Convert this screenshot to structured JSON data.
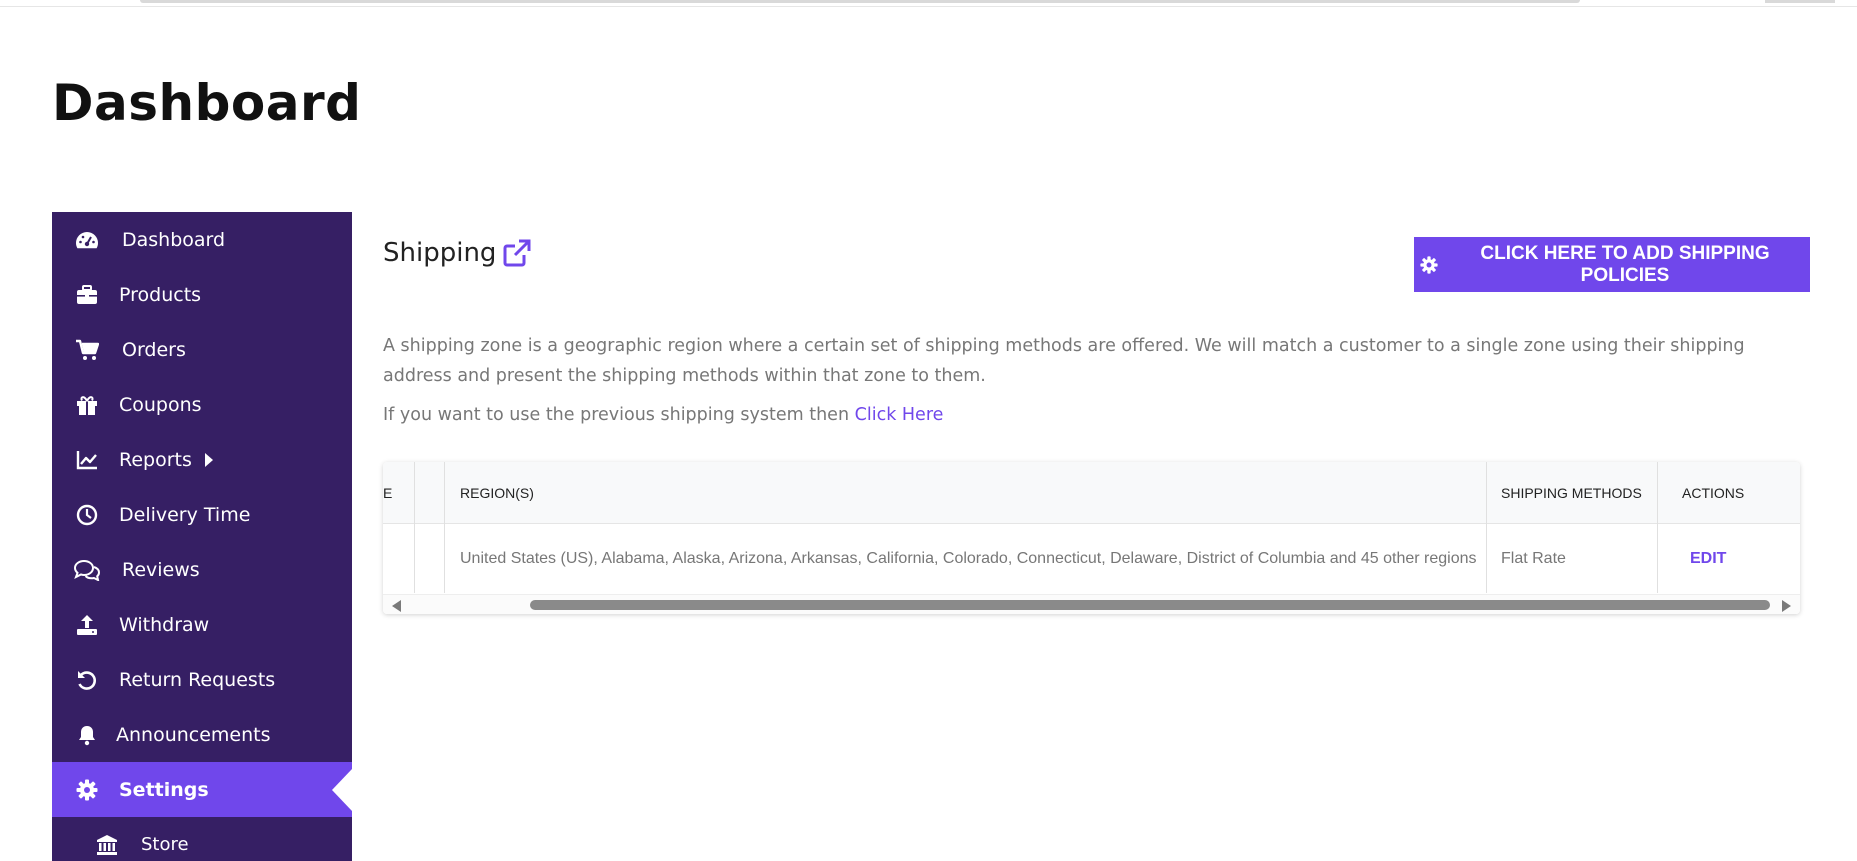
{
  "page": {
    "title": "Dashboard"
  },
  "sidebar": {
    "items": [
      {
        "label": "Dashboard",
        "icon": "dashboard-gauge-icon"
      },
      {
        "label": "Products",
        "icon": "briefcase-icon"
      },
      {
        "label": "Orders",
        "icon": "cart-icon"
      },
      {
        "label": "Coupons",
        "icon": "gift-icon"
      },
      {
        "label": "Reports",
        "icon": "chart-line-icon"
      },
      {
        "label": "Delivery Time",
        "icon": "clock-icon"
      },
      {
        "label": "Reviews",
        "icon": "comments-icon"
      },
      {
        "label": "Withdraw",
        "icon": "upload-icon"
      },
      {
        "label": "Return Requests",
        "icon": "undo-icon"
      },
      {
        "label": "Announcements",
        "icon": "bell-icon"
      },
      {
        "label": "Settings",
        "icon": "gear-icon",
        "active": true
      },
      {
        "label": "Store",
        "icon": "bank-icon"
      }
    ]
  },
  "shipping": {
    "title": "Shipping",
    "add_button_label": "CLICK HERE TO ADD SHIPPING POLICIES",
    "description": "A shipping zone is a geographic region where a certain set of shipping methods are offered. We will match a customer to a single zone using their shipping address and present the shipping methods within that zone to them.",
    "previous_text": "If you want to use the previous shipping system then",
    "previous_link": "Click Here"
  },
  "table": {
    "headers": {
      "zone_partial": "E",
      "regions": "REGION(S)",
      "methods": "SHIPPING METHODS",
      "actions": "ACTIONS"
    },
    "rows": [
      {
        "regions": "United States (US), Alabama, Alaska, Arizona, Arkansas, California, Colorado, Connecticut, Delaware, District of Columbia and 45 other regions",
        "methods": "Flat Rate",
        "action": "EDIT"
      }
    ]
  },
  "colors": {
    "sidebar_bg": "#361f64",
    "accent": "#7047eb",
    "muted_text": "#777777"
  }
}
